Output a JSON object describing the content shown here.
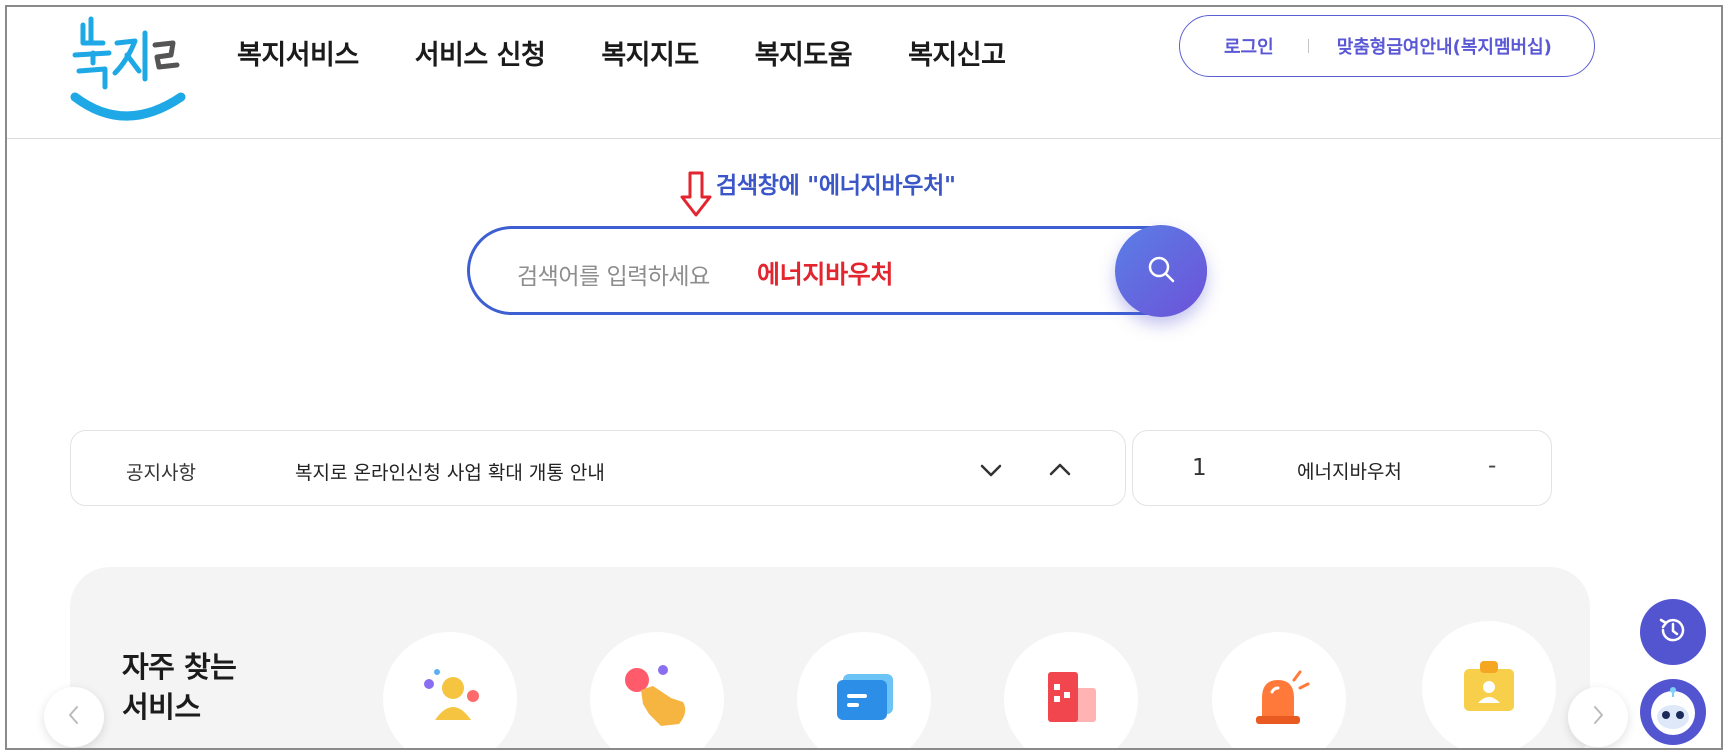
{
  "header": {
    "logo_text": "복지로",
    "nav": [
      "복지서비스",
      "서비스 신청",
      "복지지도",
      "복지도움",
      "복지신고"
    ],
    "login_label": "로그인",
    "membership_label": "맞춤형급여안내(복지멤버십)"
  },
  "annotation": {
    "text": "검색창에 \"에너지바우처\""
  },
  "search": {
    "placeholder": "검색어를 입력하세요",
    "value": "에너지바우처",
    "button_icon": "search-icon"
  },
  "notice": {
    "label": "공지사항",
    "text": "복지로 온라인신청 사업 확대 개통 안내"
  },
  "rank": {
    "number": "1",
    "term": "에너지바우처",
    "change": "-"
  },
  "services": {
    "title_line1": "자주 찾는",
    "title_line2": "서비스",
    "icons": [
      "people-icon",
      "hand-pointer-icon",
      "message-card-icon",
      "building-icon",
      "siren-icon",
      "id-card-icon"
    ]
  },
  "colors": {
    "accent": "#5b58d6",
    "search_border": "#3e5fd2",
    "search_value": "#e2252e",
    "annotation": "#3a56c7",
    "logo_blue": "#1ea9e6"
  }
}
